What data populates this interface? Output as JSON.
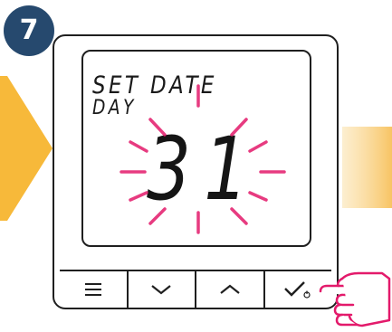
{
  "step": {
    "number": "7"
  },
  "lcd": {
    "line1": "SET DATE",
    "line2": "DAY",
    "value": "31"
  },
  "buttons": [
    {
      "name": "menu",
      "icon": "hamburger-menu-icon"
    },
    {
      "name": "down",
      "icon": "chevron-down-icon"
    },
    {
      "name": "up",
      "icon": "chevron-up-icon"
    },
    {
      "name": "confirm",
      "icon": "checkmark-power-icon"
    }
  ],
  "colors": {
    "badge": "#26496e",
    "arrow": "#f7b93a",
    "highlight": "#e31a6b",
    "outline": "#1f1f1f",
    "hand_outline": "#e31a6b"
  }
}
